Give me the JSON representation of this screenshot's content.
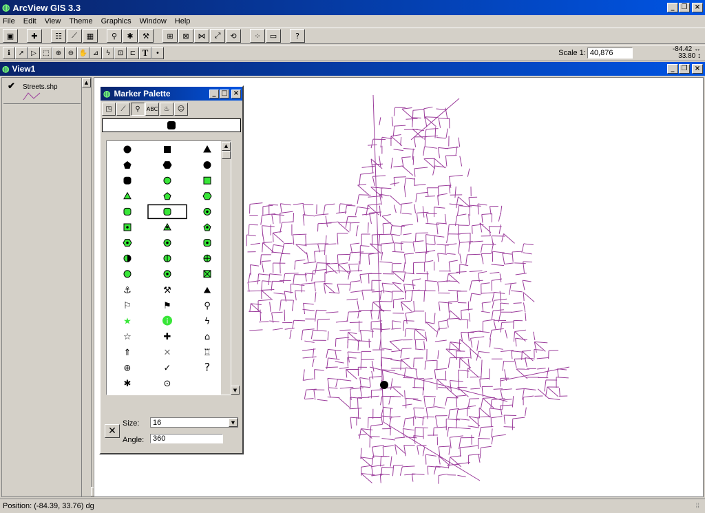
{
  "app": {
    "title": "ArcView GIS 3.3"
  },
  "menu": [
    "File",
    "Edit",
    "View",
    "Theme",
    "Graphics",
    "Window",
    "Help"
  ],
  "toolbar": {
    "scale_label": "Scale 1:",
    "scale_value": "40,876",
    "coord_x": "-84.42",
    "coord_y": "33.80"
  },
  "view": {
    "title": "View1"
  },
  "toc": {
    "theme_name": "Streets.shp",
    "theme_color": "#9b3c9b"
  },
  "palette": {
    "title": "Marker Palette",
    "size_label": "Size:",
    "size_value": "16",
    "angle_label": "Angle:",
    "angle_value": "360"
  },
  "status": {
    "position": "Position: (-84.39, 33.76) dg"
  },
  "colors": {
    "title_bg": "#0a246a",
    "street": "#9b3c9b",
    "marker_green": "#39e639"
  }
}
